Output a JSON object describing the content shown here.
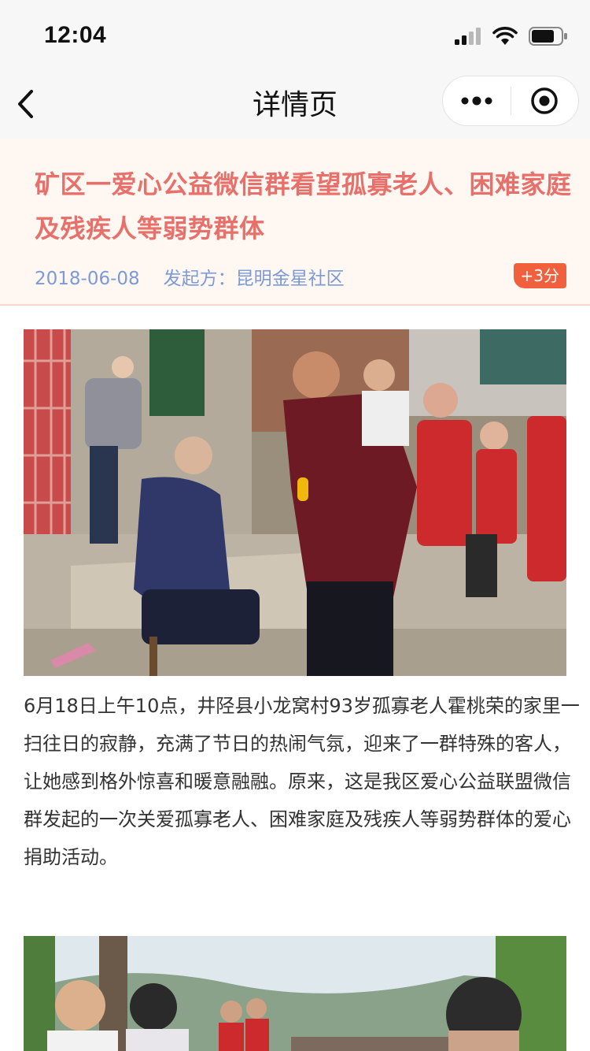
{
  "status_bar": {
    "time": "12:04"
  },
  "nav": {
    "title": "详情页"
  },
  "article": {
    "title": "矿区一爱心公益微信群看望孤寡老人、困难家庭及残疾人等弱势群体",
    "date": "2018-06-08",
    "organizer_label": "发起方：",
    "organizer": "昆明金星社区",
    "points_badge": "+3分",
    "paragraph": "6月18日上午10点，井陉县小龙窝村93岁孤寡老人霍桃荣的家里一扫往日的寂静，充满了节日的热闹气氛，迎来了一群特殊的客人，让她感到格外惊喜和暖意融融。原来，这是我区爱心公益联盟微信群发起的一次关爱孤寡老人、困难家庭及残疾人等弱势群体的爱心捐助活动。"
  },
  "colors": {
    "title": "#e8706b",
    "meta": "#7c9ad8",
    "badge": "#f1603d",
    "header_bg": "#fff7f2",
    "bar_bg": "#f7f7f7"
  },
  "icons": [
    "signal-icon",
    "wifi-icon",
    "battery-icon",
    "back-icon",
    "more-icon",
    "target-icon"
  ]
}
